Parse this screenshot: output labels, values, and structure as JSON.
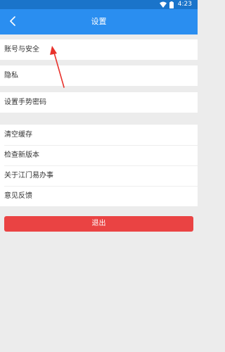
{
  "status_bar": {
    "time": "4:23"
  },
  "nav": {
    "title": "设置"
  },
  "settings": {
    "group1": [
      {
        "label": "账号与安全"
      }
    ],
    "group2": [
      {
        "label": "隐私"
      }
    ],
    "group3": [
      {
        "label": "设置手势密码"
      }
    ],
    "group4": [
      {
        "label": "清空缓存"
      },
      {
        "label": "检查新版本"
      },
      {
        "label": "关于江门易办事"
      },
      {
        "label": "意见反馈"
      }
    ]
  },
  "logout_label": "退出",
  "colors": {
    "nav_bar": "#2a8ef0",
    "status_bar": "#1a74ca",
    "logout": "#ea4343",
    "annotation": "#e8322c",
    "background": "#ececec"
  },
  "icons": {
    "back": "chevron-left-icon",
    "wifi": "wifi-icon",
    "battery": "battery-icon"
  }
}
